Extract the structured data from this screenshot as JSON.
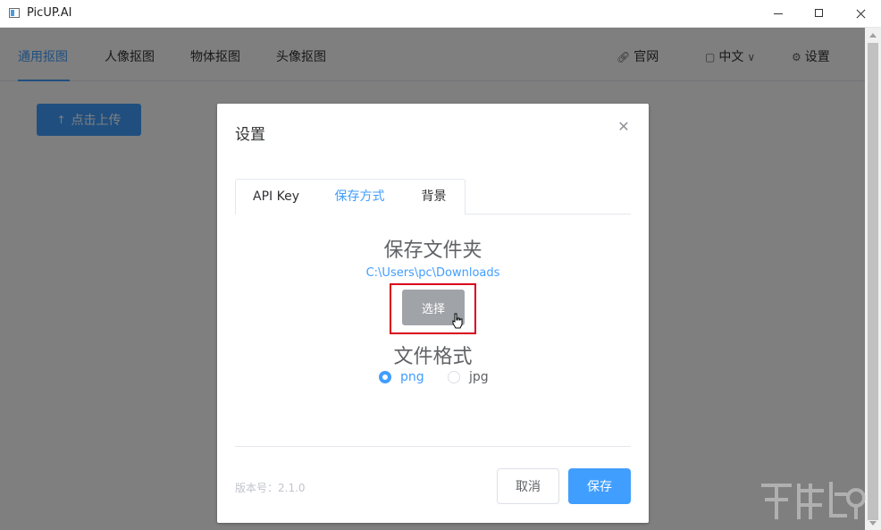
{
  "window": {
    "title": "PicUP.AI"
  },
  "nav": {
    "tabs": [
      {
        "label": "通用抠图",
        "active": true
      },
      {
        "label": "人像抠图"
      },
      {
        "label": "物体抠图"
      },
      {
        "label": "头像抠图"
      }
    ],
    "website_label": "官网",
    "language_label": "中文",
    "settings_label": "设置",
    "website_icon": "link-icon",
    "language_icon": "chat-icon",
    "settings_icon": "gear-icon"
  },
  "upload": {
    "label": "点击上传",
    "icon": "upload-icon"
  },
  "dialog": {
    "title": "设置",
    "tabs": [
      {
        "label": "API Key"
      },
      {
        "label": "保存方式",
        "active": true
      },
      {
        "label": "背景"
      }
    ],
    "folder_title": "保存文件夹",
    "folder_path": "C:\\Users\\pc\\Downloads",
    "choose_label": "选择",
    "format_title": "文件格式",
    "formats": [
      {
        "label": "png",
        "checked": true
      },
      {
        "label": "jpg",
        "checked": false
      }
    ],
    "version": "版本号：2.1.0",
    "cancel_label": "取消",
    "save_label": "保存"
  },
  "colors": {
    "accent": "#409eff",
    "highlight": "#d9001b"
  }
}
